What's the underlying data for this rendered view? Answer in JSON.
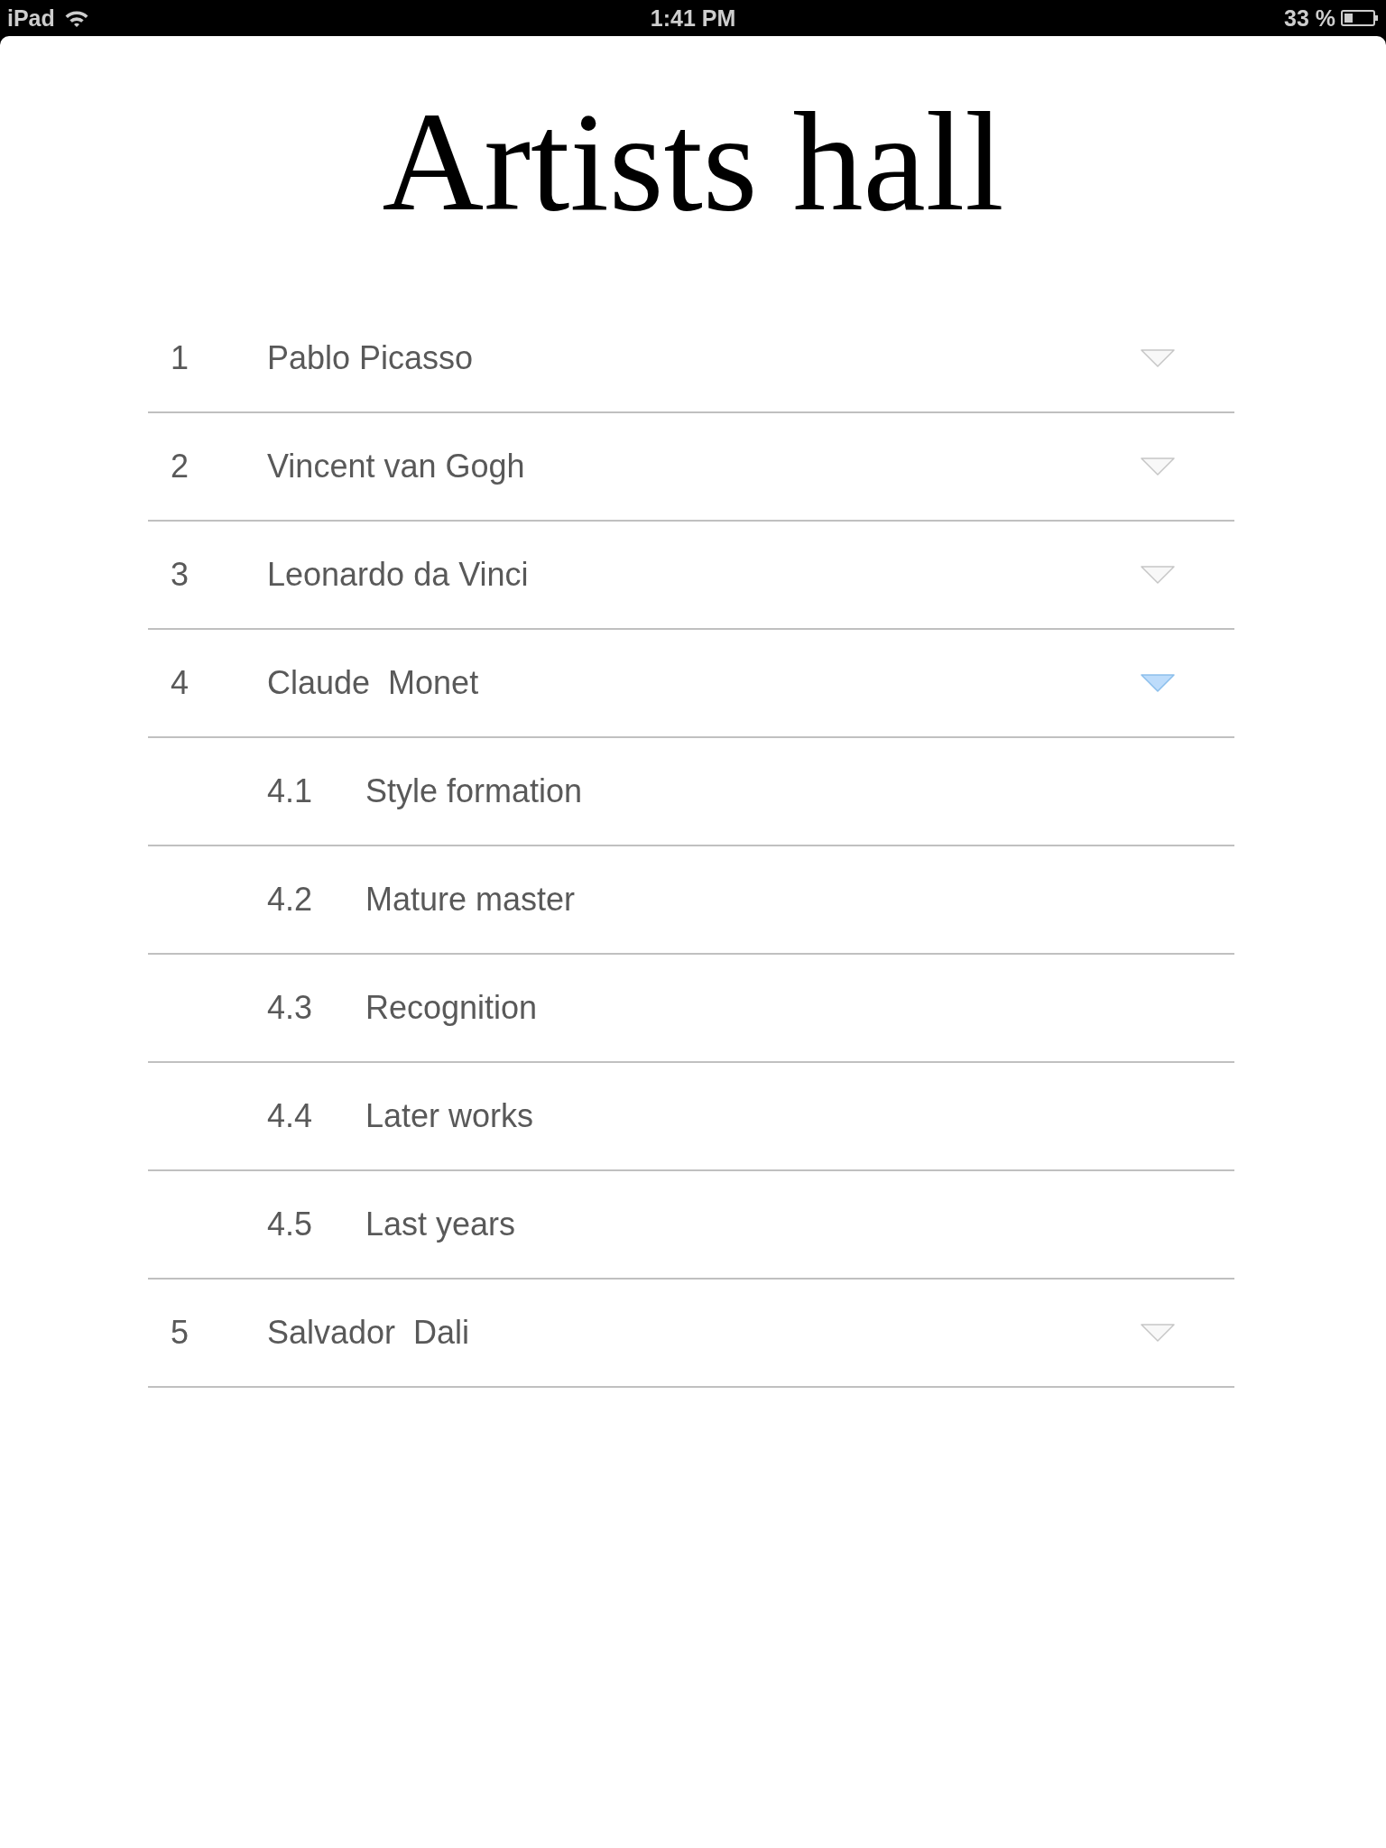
{
  "status_bar": {
    "device": "iPad",
    "time": "1:41 PM",
    "battery": "33 %"
  },
  "title": "Artists hall",
  "artists": [
    {
      "number": "1",
      "name": "Pablo Picasso",
      "expanded": false
    },
    {
      "number": "2",
      "name": "Vincent van Gogh",
      "expanded": false
    },
    {
      "number": "3",
      "name": "Leonardo da Vinci",
      "expanded": false
    },
    {
      "number": "4",
      "name": "Claude  Monet",
      "expanded": true,
      "children": [
        {
          "number": "4.1",
          "name": "Style formation"
        },
        {
          "number": "4.2",
          "name": "Mature master"
        },
        {
          "number": "4.3",
          "name": "Recognition"
        },
        {
          "number": "4.4",
          "name": "Later works"
        },
        {
          "number": "4.5",
          "name": "Last years"
        }
      ]
    },
    {
      "number": "5",
      "name": "Salvador  Dali",
      "expanded": false
    }
  ]
}
